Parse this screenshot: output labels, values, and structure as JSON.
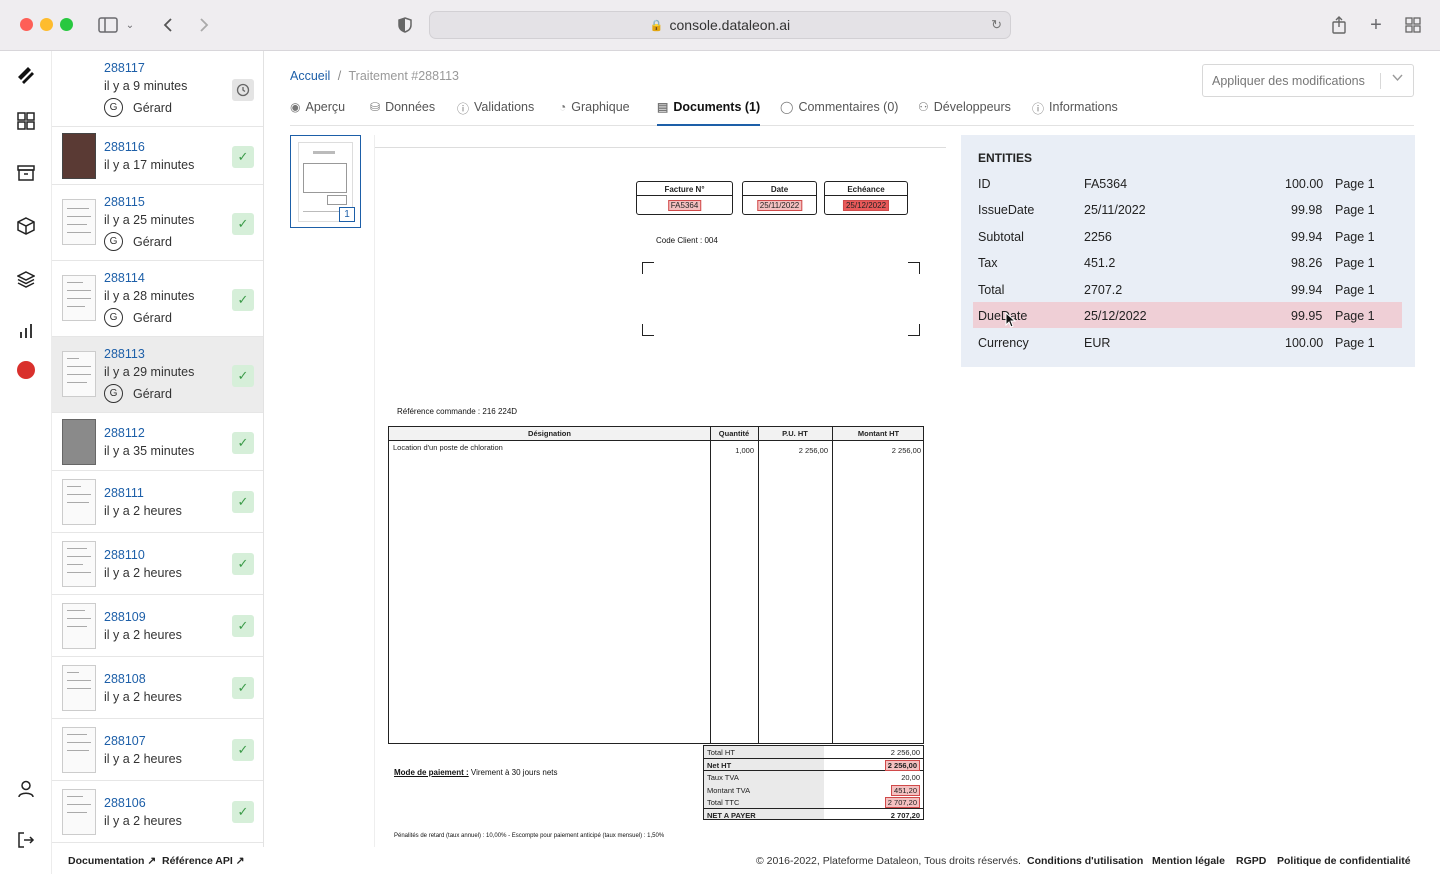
{
  "browser": {
    "url": "console.dataleon.ai"
  },
  "breadcrumb": {
    "home": "Accueil",
    "separator": "/",
    "current": "Traitement #288113"
  },
  "apply_button": {
    "label": "Appliquer des modifications"
  },
  "tabs": [
    {
      "label": "Aperçu",
      "icon": "eye-icon"
    },
    {
      "label": "Données",
      "icon": "database-icon"
    },
    {
      "label": "Validations",
      "icon": "alert-circle-icon"
    },
    {
      "label": "Graphique",
      "icon": "pie-chart-icon"
    },
    {
      "label": "Documents (1)",
      "icon": "document-icon",
      "active": true
    },
    {
      "label": "Commentaires (0)",
      "icon": "comment-icon"
    },
    {
      "label": "Développeurs",
      "icon": "user-icon"
    },
    {
      "label": "Informations",
      "icon": "info-icon"
    }
  ],
  "jobs": [
    {
      "id": "288117",
      "ago": "il y a 9 minutes",
      "user": "Gérard",
      "user_initial": "G",
      "status": "pending"
    },
    {
      "id": "288116",
      "ago": "il y a 17 minutes",
      "status": "ok"
    },
    {
      "id": "288115",
      "ago": "il y a 25 minutes",
      "user": "Gérard",
      "user_initial": "G",
      "status": "ok"
    },
    {
      "id": "288114",
      "ago": "il y a 28 minutes",
      "user": "Gérard",
      "user_initial": "G",
      "status": "ok"
    },
    {
      "id": "288113",
      "ago": "il y a 29 minutes",
      "user": "Gérard",
      "user_initial": "G",
      "status": "ok",
      "active": true
    },
    {
      "id": "288112",
      "ago": "il y a 35 minutes",
      "status": "ok"
    },
    {
      "id": "288111",
      "ago": "il y a 2 heures",
      "status": "ok"
    },
    {
      "id": "288110",
      "ago": "il y a 2 heures",
      "status": "ok"
    },
    {
      "id": "288109",
      "ago": "il y a 2 heures",
      "status": "ok"
    },
    {
      "id": "288108",
      "ago": "il y a 2 heures",
      "status": "ok"
    },
    {
      "id": "288107",
      "ago": "il y a 2 heures",
      "status": "ok"
    },
    {
      "id": "288106",
      "ago": "il y a 2 heures",
      "status": "ok"
    }
  ],
  "page_thumb": {
    "number": "1"
  },
  "invoice": {
    "boxes": [
      {
        "label": "Facture N°",
        "value": "FA5364"
      },
      {
        "label": "Date",
        "value": "25/11/2022"
      },
      {
        "label": "Echéance",
        "value": "25/12/2022"
      }
    ],
    "code_client": "Code Client : 004",
    "reference": "Référence commande : 216 224D",
    "table_headers": [
      "Désignation",
      "Quantité",
      "P.U. HT",
      "Montant HT"
    ],
    "line": {
      "designation": "Location d'un poste de chloration",
      "qty": "1,000",
      "pu": "2 256,00",
      "amount": "2 256,00"
    },
    "payment_label": "Mode de paiement :",
    "payment_value": "Virement à 30 jours nets",
    "totals": [
      {
        "label": "Total HT",
        "value": "2 256,00"
      },
      {
        "label": "Net HT",
        "value": "2 256,00",
        "bold": true,
        "hl": true
      },
      {
        "label": "Taux TVA",
        "value": "20,00"
      },
      {
        "label": "Montant TVA",
        "value": "451,20",
        "hl": true
      },
      {
        "label": "Total TTC",
        "value": "2 707,20",
        "hl": true
      },
      {
        "label": "NET A PAYER",
        "value": "2 707,20",
        "bold": true
      }
    ],
    "penalty": "Pénalités de retard (taux annuel) : 10,00% - Escompte pour paiement anticipé (taux mensuel) : 1,50%"
  },
  "entities": {
    "title": "ENTITIES",
    "rows": [
      {
        "name": "ID",
        "value": "FA5364",
        "score": "100.00",
        "page": "Page 1"
      },
      {
        "name": "IssueDate",
        "value": "25/11/2022",
        "score": "99.98",
        "page": "Page 1"
      },
      {
        "name": "Subtotal",
        "value": "2256",
        "score": "99.94",
        "page": "Page 1"
      },
      {
        "name": "Tax",
        "value": "451.2",
        "score": "98.26",
        "page": "Page 1"
      },
      {
        "name": "Total",
        "value": "2707.2",
        "score": "99.94",
        "page": "Page 1"
      },
      {
        "name": "DueDate",
        "value": "25/12/2022",
        "score": "99.95",
        "page": "Page 1",
        "highlighted": true
      },
      {
        "name": "Currency",
        "value": "EUR",
        "score": "100.00",
        "page": "Page 1"
      }
    ]
  },
  "footer": {
    "documentation": "Documentation",
    "api_reference": "Référence API",
    "copyright": "© 2016-2022, Plateforme Dataleon, Tous droits réservés.",
    "terms": "Conditions d'utilisation",
    "legal": "Mention légale",
    "rgpd": "RGPD",
    "privacy": "Politique de confidentialité"
  },
  "colors": {
    "accent": "#1d5fa8",
    "ok_bg": "#d6efd9",
    "ok_fg": "#3c9b49",
    "entities_bg": "#e9eef6",
    "entity_highlight": "#efcfd6",
    "record_red": "#d9302c"
  }
}
